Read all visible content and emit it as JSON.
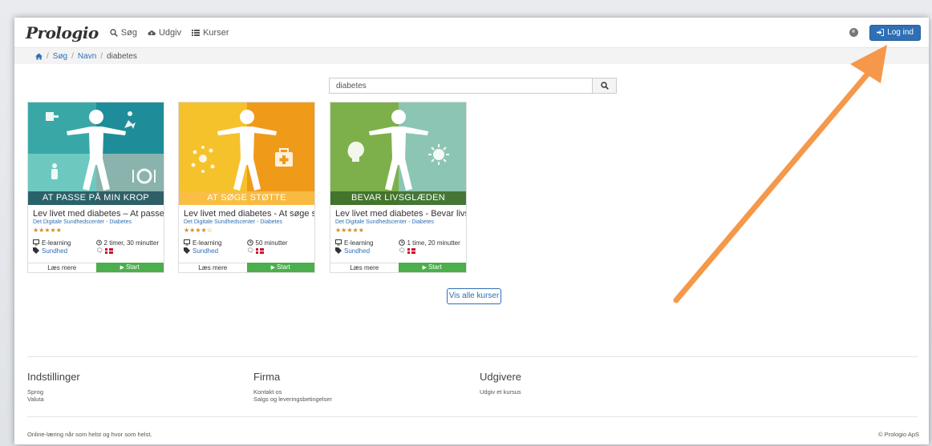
{
  "navbar": {
    "logo": "Prologio",
    "items": [
      {
        "label": "Søg",
        "icon": "search-icon"
      },
      {
        "label": "Udgiv",
        "icon": "cloud-upload-icon"
      },
      {
        "label": "Kurser",
        "icon": "list-icon"
      }
    ],
    "login_label": "Log ind"
  },
  "breadcrumb": {
    "items": [
      "Søg",
      "Navn"
    ],
    "current": "diabetes"
  },
  "search": {
    "value": "diabetes",
    "placeholder": ""
  },
  "cards": [
    {
      "banner": "AT PASSE PÅ MIN KROP",
      "title": "Lev livet med diabetes – At passe ...",
      "publisher": "Det Digitale Sundhedscenter - Diabetes",
      "stars": "★★★★★",
      "type": "E-learning",
      "category": "Sundhed",
      "duration": "2 timer, 30 minutter",
      "more_label": "Læs mere",
      "start_label": "Start"
    },
    {
      "banner": "AT SØGE STØTTE",
      "title": "Lev livet med diabetes - At søge s...",
      "publisher": "Det Digitale Sundhedscenter - Diabetes",
      "stars": "★★★★☆",
      "type": "E-learning",
      "category": "Sundhed",
      "duration": "50 minutter",
      "more_label": "Læs mere",
      "start_label": "Start"
    },
    {
      "banner": "BEVAR LIVSGLÆDEN",
      "title": "Lev livet med diabetes - Bevar livs...",
      "publisher": "Det Digitale Sundhedscenter - Diabetes",
      "stars": "★★★★★",
      "type": "E-learning",
      "category": "Sundhed",
      "duration": "1 time, 20 minutter",
      "more_label": "Læs mere",
      "start_label": "Start"
    }
  ],
  "all_courses_label": "Vis alle kurser",
  "footer": {
    "settings": {
      "title": "Indstillinger",
      "links": [
        "Sprog",
        "Valuta"
      ]
    },
    "company": {
      "title": "Firma",
      "links": [
        "Kontakt os",
        "Salgs og leveringsbetingelser"
      ]
    },
    "publishers": {
      "title": "Udgivere",
      "links": [
        "Udgiv et kursus"
      ]
    },
    "tagline": "Online-læring når som helst og hvor som helst.",
    "copyright": "© Prologio ApS"
  },
  "colors": {
    "primary": "#2f6fb5",
    "success": "#4cae4c",
    "arrow": "#f5984a"
  }
}
